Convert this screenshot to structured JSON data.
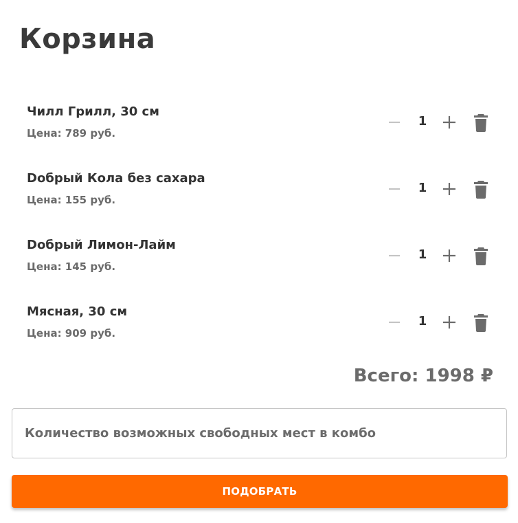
{
  "page": {
    "title": "Корзина"
  },
  "cart": {
    "items": [
      {
        "name": "Чилл Грилл, 30 см",
        "price": "Цена: 789 руб.",
        "quantity": "1"
      },
      {
        "name": "Dобрый Кола без сахара",
        "price": "Цена: 155 руб.",
        "quantity": "1"
      },
      {
        "name": "Dобрый Лимон-Лайм",
        "price": "Цена: 145 руб.",
        "quantity": "1"
      },
      {
        "name": "Мясная, 30 см",
        "price": "Цена: 909 руб.",
        "quantity": "1"
      }
    ],
    "total": "Всего: 1998 ₽"
  },
  "combo": {
    "placeholder": "Количество возможных свободных мест в комбо",
    "value": ""
  },
  "actions": {
    "submit_label": "ПОДОБРАТЬ"
  },
  "icons": {
    "minus": "minus-icon",
    "plus": "plus-icon",
    "delete": "trash-icon"
  },
  "colors": {
    "accent": "#ff6900",
    "icon_disabled": "#c4c4c4",
    "icon": "#6b6b6b",
    "text": "#333333"
  }
}
